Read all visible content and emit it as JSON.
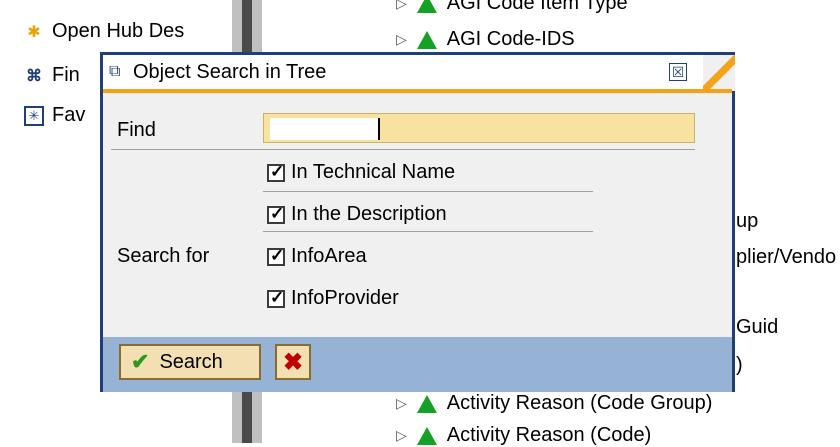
{
  "left_panel": {
    "items": [
      {
        "label": "Open Hub Des",
        "icon": "open-hub-icon"
      },
      {
        "label": "Fin",
        "icon": "binoculars-icon"
      },
      {
        "label": "Fav",
        "icon": "favorites-icon"
      }
    ]
  },
  "tree": {
    "items": [
      {
        "label": "AGI Code Item Type"
      },
      {
        "label": "AGI Code-IDS"
      },
      {
        "label": "up"
      },
      {
        "label": "plier/Vendo"
      },
      {
        "label": "Guid"
      },
      {
        "label": ")"
      },
      {
        "label": "Activity Reason (Code Group)"
      },
      {
        "label": "Activity Reason (Code)"
      }
    ]
  },
  "dialog": {
    "title": "Object Search in Tree",
    "close_symbol": "☒",
    "find_label": "Find",
    "find_value": "",
    "search_for_label": "Search for",
    "options": [
      {
        "label": "In Technical Name",
        "checked": true
      },
      {
        "label": "In the Description",
        "checked": true
      },
      {
        "label": "InfoArea",
        "checked": true
      },
      {
        "label": "InfoProvider",
        "checked": true
      }
    ],
    "search_button": "Search",
    "cancel_symbol": "✖"
  },
  "colors": {
    "dialog_border": "#1f3f78",
    "title_accent": "#f3a21a",
    "input_bg": "#f9e29f",
    "footer_bg": "#96b3d6",
    "button_bg": "#f2e0b2"
  }
}
